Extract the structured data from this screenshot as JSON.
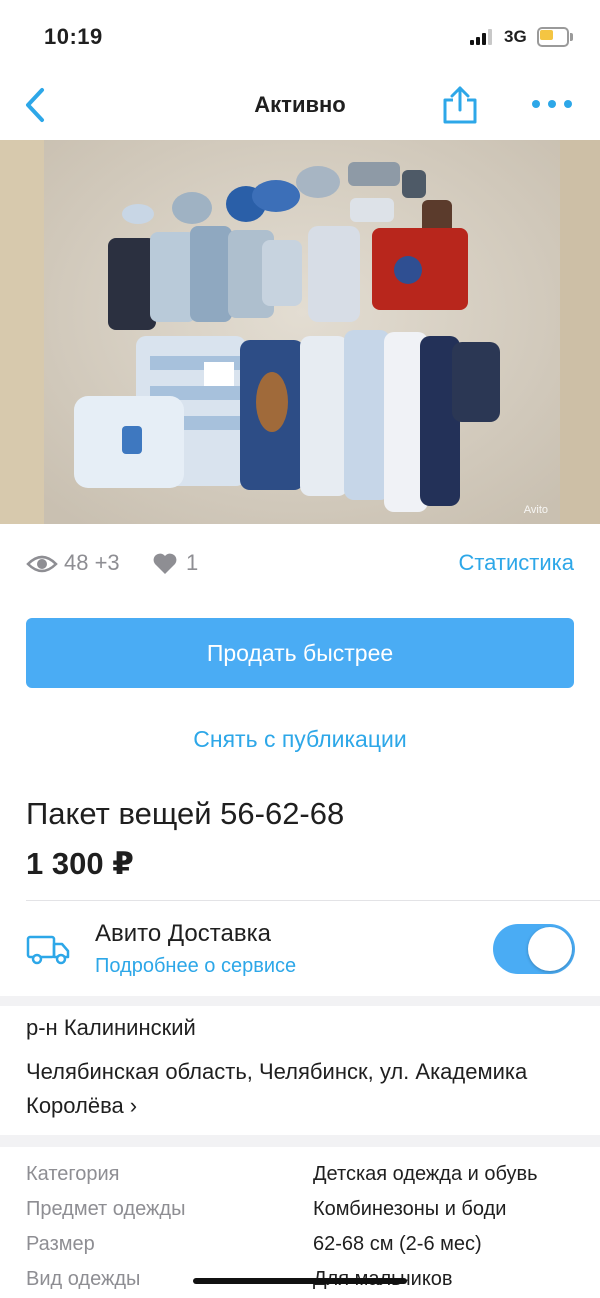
{
  "status_bar": {
    "time": "10:19",
    "network": "3G"
  },
  "nav": {
    "title": "Активно"
  },
  "photo": {
    "watermark": "Avito"
  },
  "stats": {
    "views": "48 +3",
    "favorites": "1",
    "statistics_link": "Статистика"
  },
  "actions": {
    "sell_faster": "Продать быстрее",
    "unpublish": "Снять с публикации"
  },
  "listing": {
    "title": "Пакет вещей 56-62-68",
    "price": "1 300 ₽"
  },
  "delivery": {
    "title": "Авито Доставка",
    "link": "Подробнее о сервисе",
    "enabled": true
  },
  "location": {
    "district": "р-н Калининский",
    "address": "Челябинская область, Челябинск, ул. Академика Королёва",
    "chevron": "›"
  },
  "params": [
    {
      "label": "Категория",
      "value": "Детская одежда и обувь"
    },
    {
      "label": "Предмет одежды",
      "value": "Комбинезоны и боди"
    },
    {
      "label": "Размер",
      "value": "62-68 см (2-6 мес)"
    },
    {
      "label": "Вид одежды",
      "value": "Для мальчиков"
    }
  ],
  "colors": {
    "accent": "#4aacf4",
    "link": "#2da7e8",
    "muted": "#8e8e93",
    "battery": "#f4c542"
  }
}
